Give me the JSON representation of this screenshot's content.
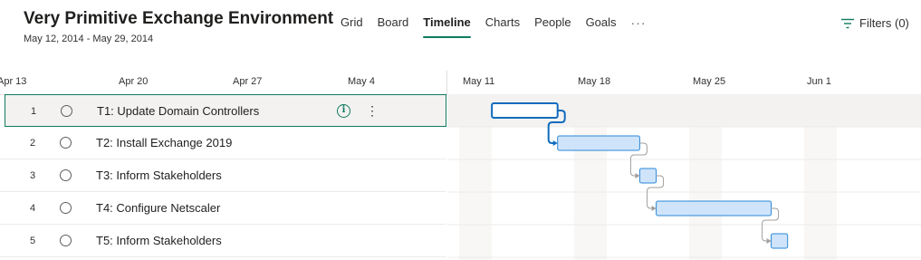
{
  "header": {
    "title": "Very Primitive Exchange Environment",
    "date_range": "May 12, 2014 - May 29, 2014",
    "tabs": [
      {
        "label": "Grid",
        "active": false
      },
      {
        "label": "Board",
        "active": false
      },
      {
        "label": "Timeline",
        "active": true
      },
      {
        "label": "Charts",
        "active": false
      },
      {
        "label": "People",
        "active": false
      },
      {
        "label": "Goals",
        "active": false
      }
    ],
    "more_label": "···",
    "filters_label": "Filters (0)",
    "filters_icon": "filter-icon",
    "accent_color": "#0f7b5f"
  },
  "timeline": {
    "axis_labels": [
      "Apr 13",
      "Apr 20",
      "Apr 27",
      "May 4",
      "May 11",
      "May 18",
      "May 25",
      "Jun 1"
    ]
  },
  "tasks": [
    {
      "number": "1",
      "name": "T1: Update Domain Controllers",
      "selected": true,
      "start": "2014-05-12",
      "end": "2014-05-15"
    },
    {
      "number": "2",
      "name": "T2: Install Exchange 2019",
      "selected": false,
      "start": "2014-05-16",
      "end": "2014-05-20"
    },
    {
      "number": "3",
      "name": "T3: Inform Stakeholders",
      "selected": false,
      "start": "2014-05-21",
      "end": "2014-05-21"
    },
    {
      "number": "4",
      "name": "T4: Configure Netscaler",
      "selected": false,
      "start": "2014-05-22",
      "end": "2014-05-28"
    },
    {
      "number": "5",
      "name": "T5: Inform Stakeholders",
      "selected": false,
      "start": "2014-05-29",
      "end": "2014-05-29"
    }
  ],
  "row_icons": {
    "complete": "circle-check-icon",
    "info": "info-icon",
    "more": "more-vertical-icon"
  },
  "colors": {
    "bar_fill": "#cfe4fa",
    "bar_border": "#2b88d8",
    "selected_bar_border": "#0f6cbd",
    "weekend_shade": "#f8f7f6",
    "dependency_line": "#a19f9d",
    "selected_dependency": "#0f6cbd"
  }
}
